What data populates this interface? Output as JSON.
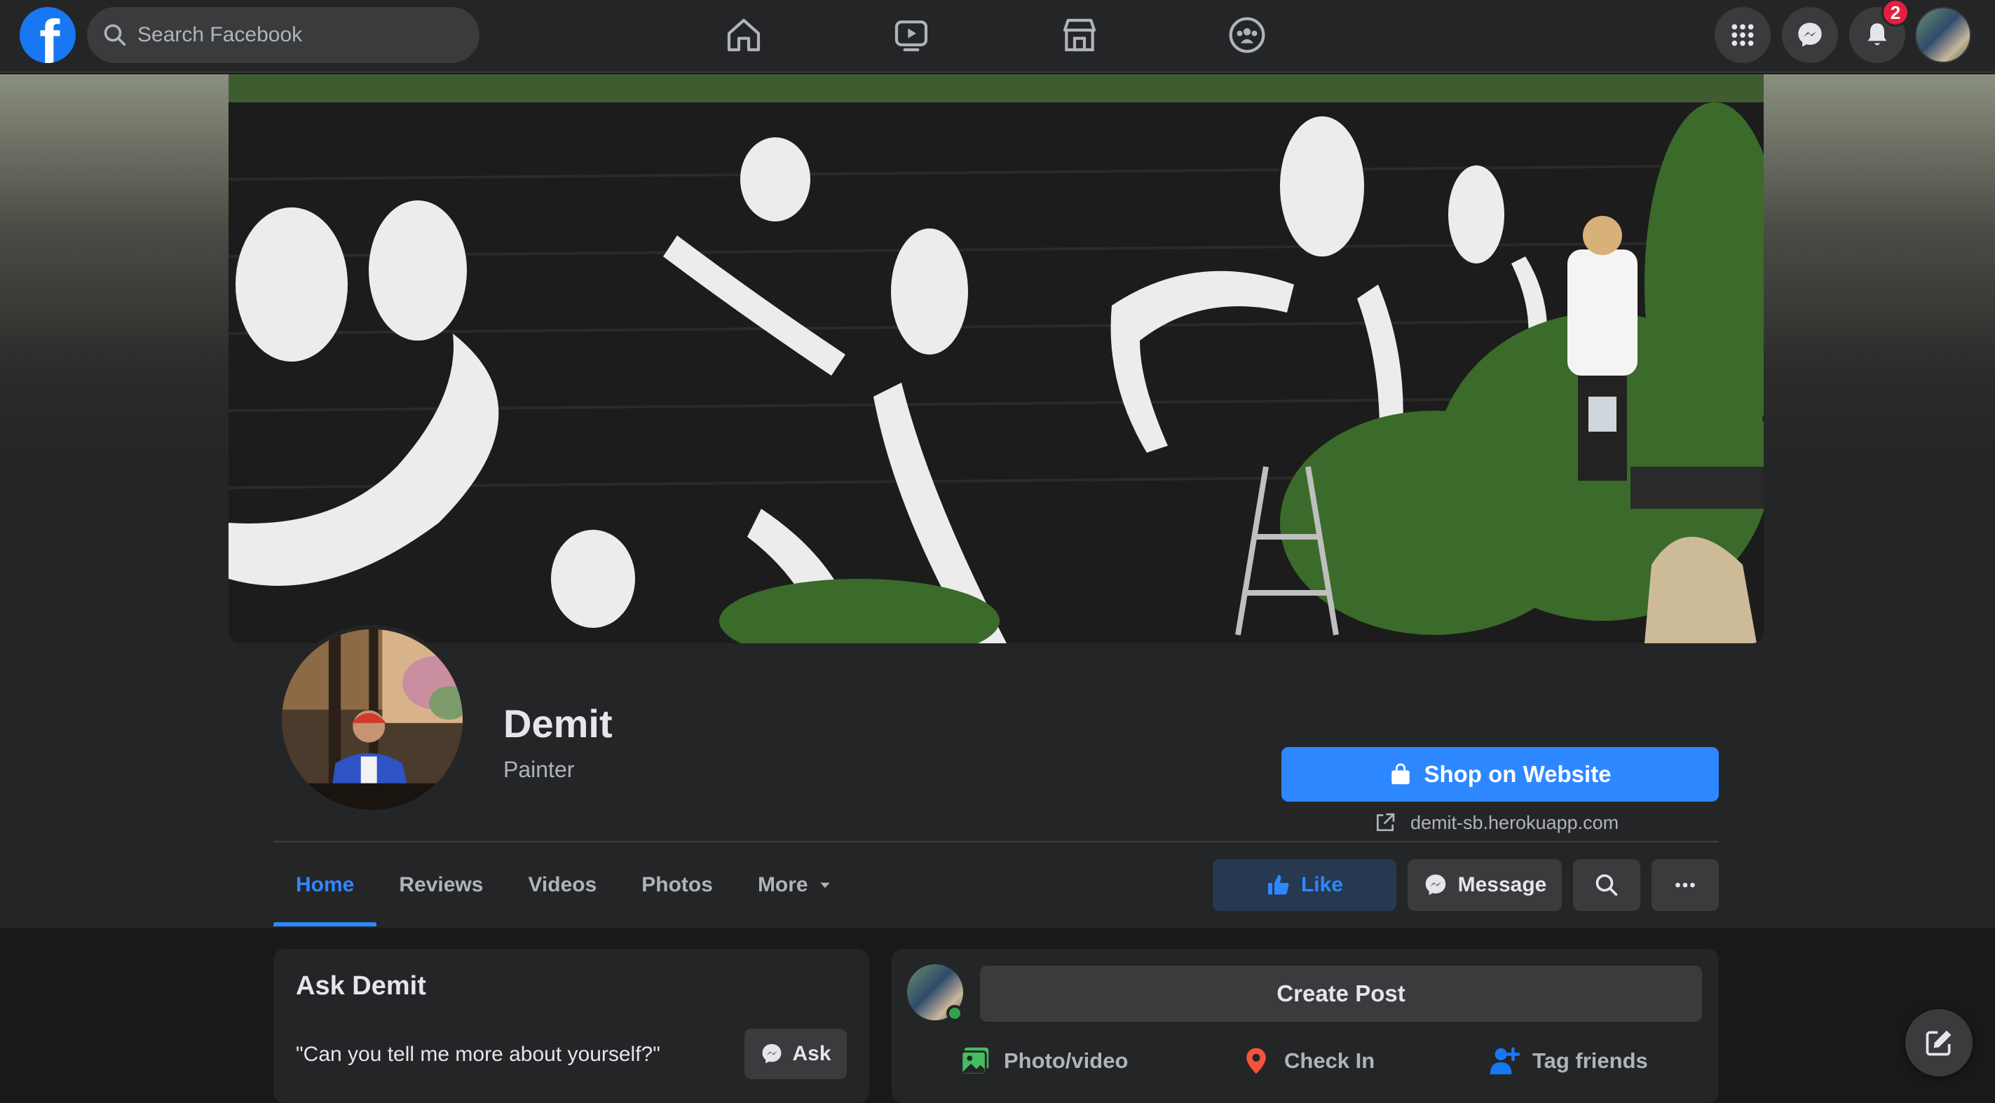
{
  "colors": {
    "accent": "#2d88ff",
    "surface": "#242526",
    "background": "#18191a",
    "badge": "#e41e3f",
    "online": "#31a24c"
  },
  "topnav": {
    "search_placeholder": "Search Facebook",
    "nav_icons": [
      "home-icon",
      "watch-icon",
      "marketplace-icon",
      "groups-icon"
    ],
    "right_icons": [
      "menu-grid-icon",
      "messenger-icon",
      "notifications-icon"
    ],
    "notification_count": "2"
  },
  "page": {
    "name": "Demit",
    "category": "Painter",
    "shop_button_label": "Shop on Website",
    "website": "demit-sb.herokuapp.com"
  },
  "tabs": [
    {
      "label": "Home",
      "active": true
    },
    {
      "label": "Reviews",
      "active": false
    },
    {
      "label": "Videos",
      "active": false
    },
    {
      "label": "Photos",
      "active": false
    },
    {
      "label": "More",
      "active": false
    }
  ],
  "actions": {
    "like_label": "Like",
    "message_label": "Message"
  },
  "ask": {
    "title": "Ask Demit",
    "question": "\"Can you tell me more about yourself?\"",
    "button_label": "Ask"
  },
  "create_post": {
    "button_label": "Create Post",
    "options": [
      "Photo/video",
      "Check In",
      "Tag friends"
    ]
  }
}
